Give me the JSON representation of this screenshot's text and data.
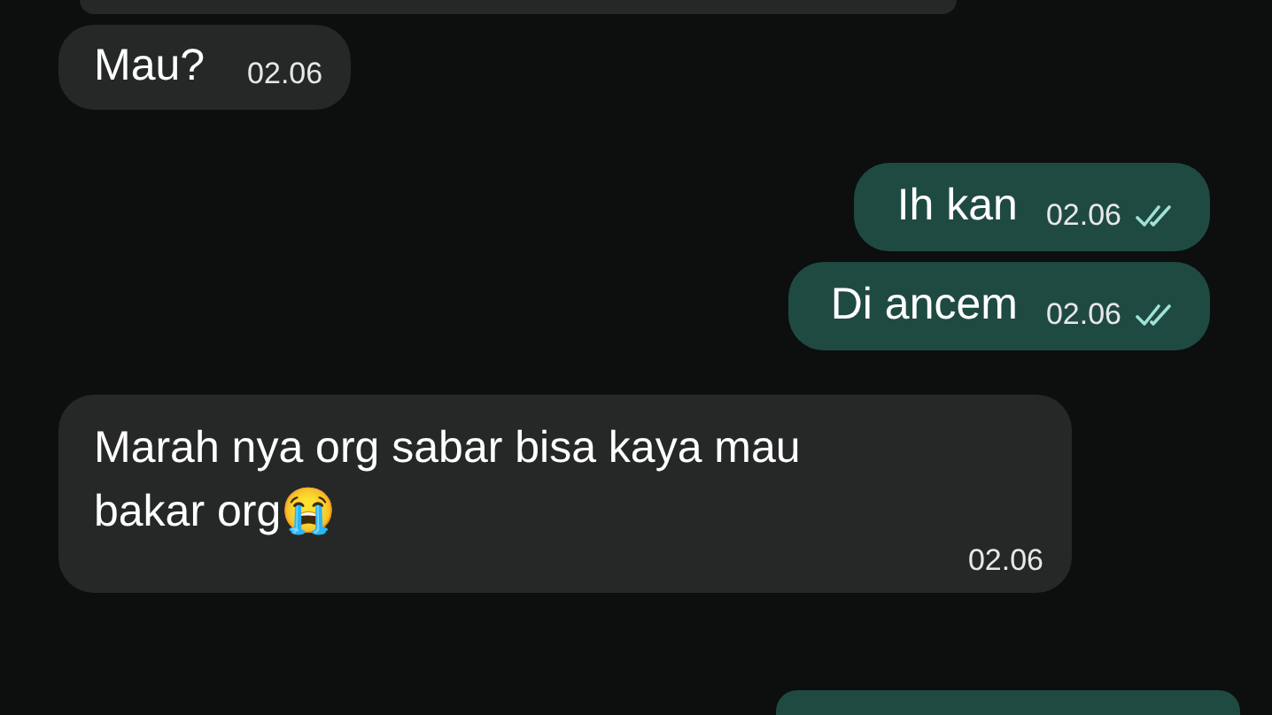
{
  "messages": [
    {
      "kind": "partial_in"
    },
    {
      "kind": "in",
      "text": "Mau?",
      "time": "02.06"
    },
    {
      "kind": "out",
      "text": "Ih kan",
      "time": "02.06",
      "read": true
    },
    {
      "kind": "out",
      "text": "Di ancem",
      "time": "02.06",
      "read": true
    },
    {
      "kind": "in_long",
      "text": "Marah nya org sabar bisa kaya mau bakar org😭",
      "time": "02.06"
    },
    {
      "kind": "partial_out"
    }
  ]
}
